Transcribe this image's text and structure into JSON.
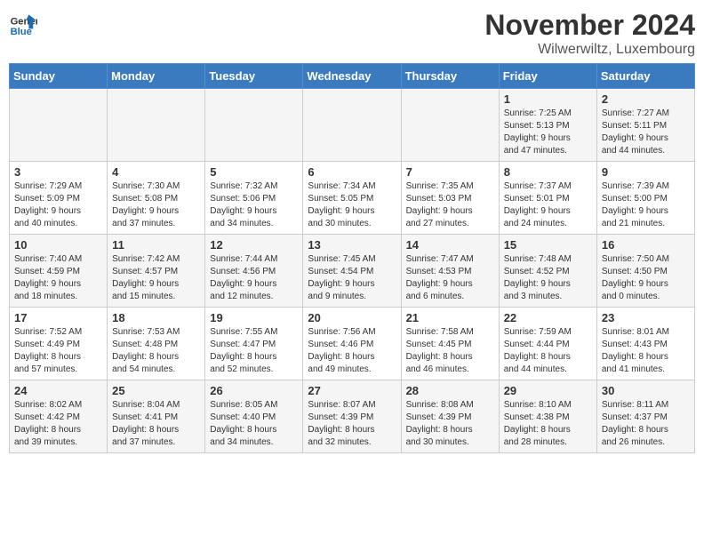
{
  "logo": {
    "line1": "General",
    "line2": "Blue"
  },
  "title": "November 2024",
  "location": "Wilwerwiltz, Luxembourg",
  "days_of_week": [
    "Sunday",
    "Monday",
    "Tuesday",
    "Wednesday",
    "Thursday",
    "Friday",
    "Saturday"
  ],
  "weeks": [
    [
      {
        "num": "",
        "info": ""
      },
      {
        "num": "",
        "info": ""
      },
      {
        "num": "",
        "info": ""
      },
      {
        "num": "",
        "info": ""
      },
      {
        "num": "",
        "info": ""
      },
      {
        "num": "1",
        "info": "Sunrise: 7:25 AM\nSunset: 5:13 PM\nDaylight: 9 hours\nand 47 minutes."
      },
      {
        "num": "2",
        "info": "Sunrise: 7:27 AM\nSunset: 5:11 PM\nDaylight: 9 hours\nand 44 minutes."
      }
    ],
    [
      {
        "num": "3",
        "info": "Sunrise: 7:29 AM\nSunset: 5:09 PM\nDaylight: 9 hours\nand 40 minutes."
      },
      {
        "num": "4",
        "info": "Sunrise: 7:30 AM\nSunset: 5:08 PM\nDaylight: 9 hours\nand 37 minutes."
      },
      {
        "num": "5",
        "info": "Sunrise: 7:32 AM\nSunset: 5:06 PM\nDaylight: 9 hours\nand 34 minutes."
      },
      {
        "num": "6",
        "info": "Sunrise: 7:34 AM\nSunset: 5:05 PM\nDaylight: 9 hours\nand 30 minutes."
      },
      {
        "num": "7",
        "info": "Sunrise: 7:35 AM\nSunset: 5:03 PM\nDaylight: 9 hours\nand 27 minutes."
      },
      {
        "num": "8",
        "info": "Sunrise: 7:37 AM\nSunset: 5:01 PM\nDaylight: 9 hours\nand 24 minutes."
      },
      {
        "num": "9",
        "info": "Sunrise: 7:39 AM\nSunset: 5:00 PM\nDaylight: 9 hours\nand 21 minutes."
      }
    ],
    [
      {
        "num": "10",
        "info": "Sunrise: 7:40 AM\nSunset: 4:59 PM\nDaylight: 9 hours\nand 18 minutes."
      },
      {
        "num": "11",
        "info": "Sunrise: 7:42 AM\nSunset: 4:57 PM\nDaylight: 9 hours\nand 15 minutes."
      },
      {
        "num": "12",
        "info": "Sunrise: 7:44 AM\nSunset: 4:56 PM\nDaylight: 9 hours\nand 12 minutes."
      },
      {
        "num": "13",
        "info": "Sunrise: 7:45 AM\nSunset: 4:54 PM\nDaylight: 9 hours\nand 9 minutes."
      },
      {
        "num": "14",
        "info": "Sunrise: 7:47 AM\nSunset: 4:53 PM\nDaylight: 9 hours\nand 6 minutes."
      },
      {
        "num": "15",
        "info": "Sunrise: 7:48 AM\nSunset: 4:52 PM\nDaylight: 9 hours\nand 3 minutes."
      },
      {
        "num": "16",
        "info": "Sunrise: 7:50 AM\nSunset: 4:50 PM\nDaylight: 9 hours\nand 0 minutes."
      }
    ],
    [
      {
        "num": "17",
        "info": "Sunrise: 7:52 AM\nSunset: 4:49 PM\nDaylight: 8 hours\nand 57 minutes."
      },
      {
        "num": "18",
        "info": "Sunrise: 7:53 AM\nSunset: 4:48 PM\nDaylight: 8 hours\nand 54 minutes."
      },
      {
        "num": "19",
        "info": "Sunrise: 7:55 AM\nSunset: 4:47 PM\nDaylight: 8 hours\nand 52 minutes."
      },
      {
        "num": "20",
        "info": "Sunrise: 7:56 AM\nSunset: 4:46 PM\nDaylight: 8 hours\nand 49 minutes."
      },
      {
        "num": "21",
        "info": "Sunrise: 7:58 AM\nSunset: 4:45 PM\nDaylight: 8 hours\nand 46 minutes."
      },
      {
        "num": "22",
        "info": "Sunrise: 7:59 AM\nSunset: 4:44 PM\nDaylight: 8 hours\nand 44 minutes."
      },
      {
        "num": "23",
        "info": "Sunrise: 8:01 AM\nSunset: 4:43 PM\nDaylight: 8 hours\nand 41 minutes."
      }
    ],
    [
      {
        "num": "24",
        "info": "Sunrise: 8:02 AM\nSunset: 4:42 PM\nDaylight: 8 hours\nand 39 minutes."
      },
      {
        "num": "25",
        "info": "Sunrise: 8:04 AM\nSunset: 4:41 PM\nDaylight: 8 hours\nand 37 minutes."
      },
      {
        "num": "26",
        "info": "Sunrise: 8:05 AM\nSunset: 4:40 PM\nDaylight: 8 hours\nand 34 minutes."
      },
      {
        "num": "27",
        "info": "Sunrise: 8:07 AM\nSunset: 4:39 PM\nDaylight: 8 hours\nand 32 minutes."
      },
      {
        "num": "28",
        "info": "Sunrise: 8:08 AM\nSunset: 4:39 PM\nDaylight: 8 hours\nand 30 minutes."
      },
      {
        "num": "29",
        "info": "Sunrise: 8:10 AM\nSunset: 4:38 PM\nDaylight: 8 hours\nand 28 minutes."
      },
      {
        "num": "30",
        "info": "Sunrise: 8:11 AM\nSunset: 4:37 PM\nDaylight: 8 hours\nand 26 minutes."
      }
    ]
  ]
}
